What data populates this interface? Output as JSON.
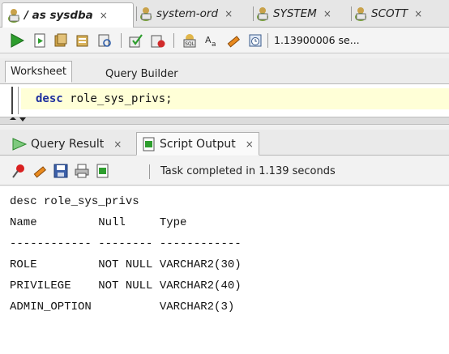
{
  "connection_tabs": [
    {
      "label": "/ as sysdba",
      "active": true
    },
    {
      "label": "system-ord",
      "active": false
    },
    {
      "label": "SYSTEM",
      "active": false
    },
    {
      "label": "SCOTT",
      "active": false
    }
  ],
  "close_glyph": "×",
  "sql_badge": "SQL",
  "toolbar": {
    "timing": "1.13900006 se...",
    "icons": [
      "run-statement-icon",
      "run-script-icon",
      "autotrace-icon",
      "explain-plan-icon",
      "sql-tuning-icon",
      "commit-icon",
      "rollback-icon",
      "unshared-sql-icon",
      "to-upper-icon",
      "clear-icon",
      "history-icon"
    ]
  },
  "worksheet_tabs": [
    "Worksheet",
    "Query Builder"
  ],
  "editor": {
    "keyword": "desc",
    "rest": " role_sys_privs;"
  },
  "result_tabs": [
    {
      "label": "Query Result",
      "active": false
    },
    {
      "label": "Script Output",
      "active": true
    }
  ],
  "output_toolbar": {
    "status": "Task completed in 1.139 seconds",
    "icons": [
      "pin-icon",
      "clear-output-icon",
      "save-icon",
      "print-icon",
      "script-output-icon"
    ]
  },
  "output": {
    "lines": [
      "desc role_sys_privs",
      "Name         Null     Type",
      "------------ -------- ------------",
      "ROLE         NOT NULL VARCHAR2(30)",
      "PRIVILEGE    NOT NULL VARCHAR2(40)",
      "ADMIN_OPTION          VARCHAR2(3)"
    ]
  },
  "colors": {
    "run_green": "#2e9e2e",
    "editor_highlight": "#ffffd7",
    "keyword_blue": "#1e2f9e"
  }
}
